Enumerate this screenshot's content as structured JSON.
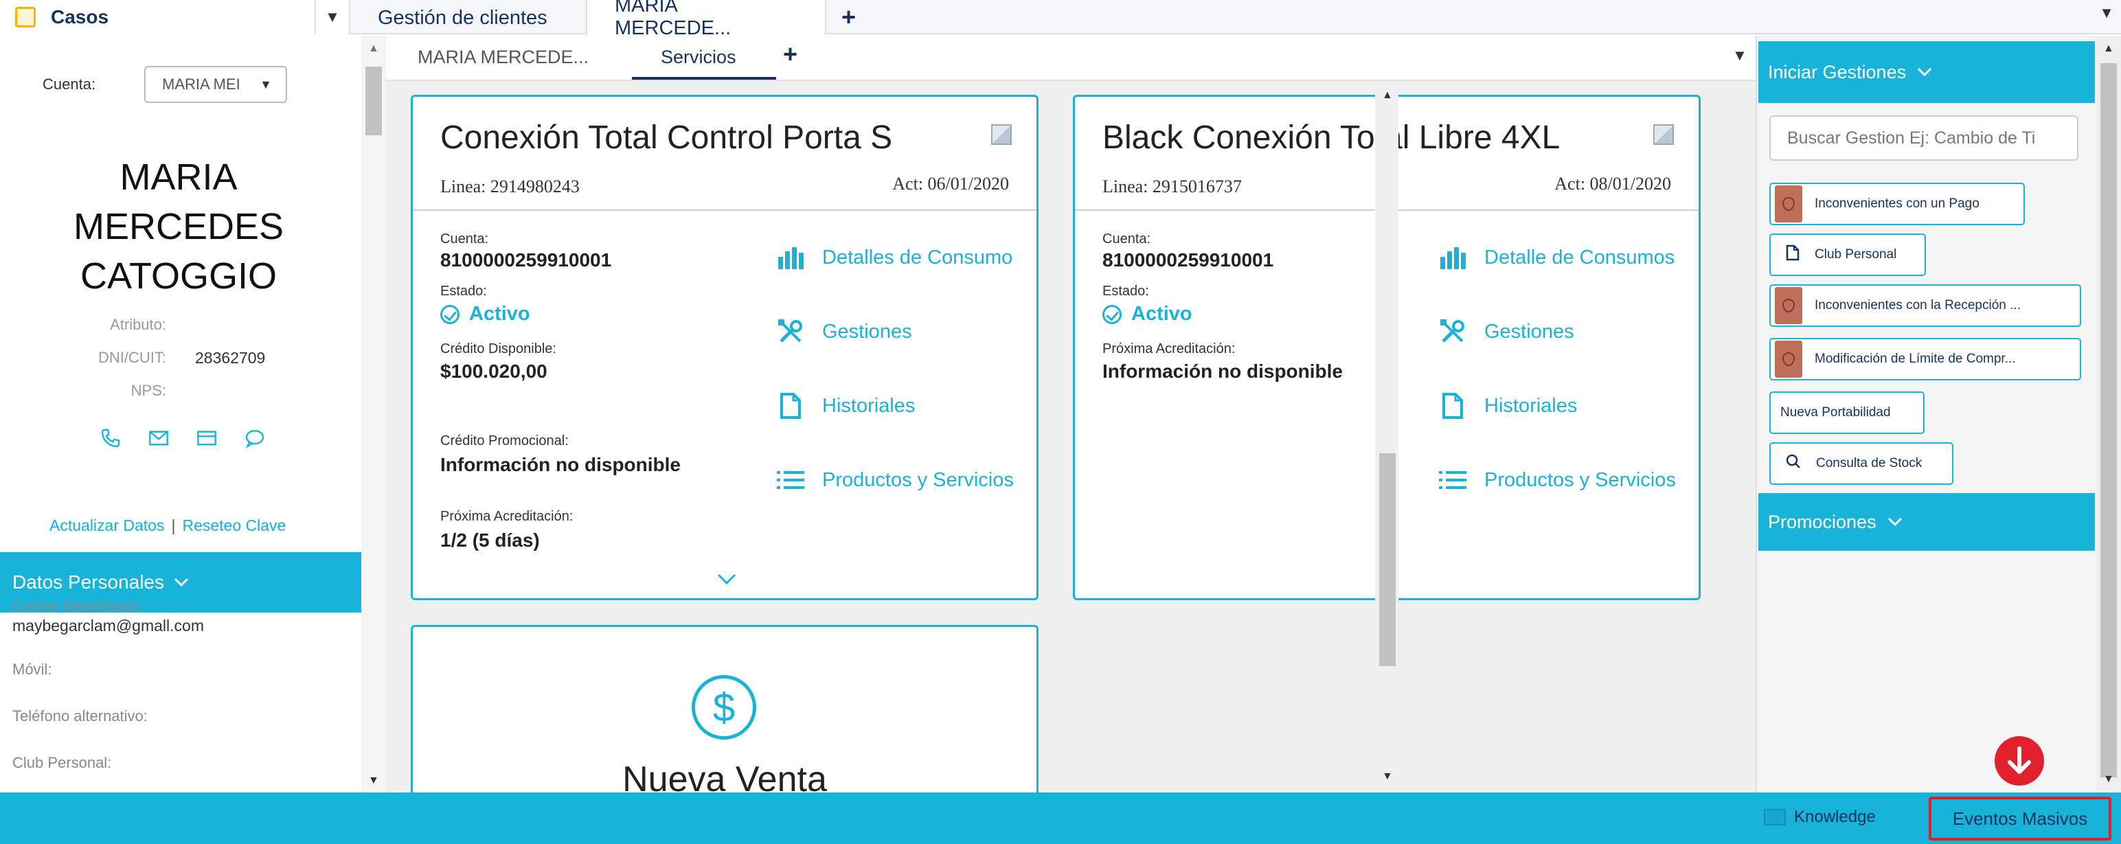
{
  "topbar": {
    "app_label": "Casos",
    "tabs": [
      {
        "label": "Gestión de clientes"
      },
      {
        "label": "MARIA MERCEDE..."
      }
    ]
  },
  "left_panel": {
    "cuenta_label": "Cuenta:",
    "cuenta_value": "MARIA MEI",
    "customer_name_lines": [
      "MARIA",
      "MERCEDES",
      "CATOGGIO"
    ],
    "atributo_label": "Atributo:",
    "dni_label": "DNI/CUIT:",
    "dni_value": "28362709",
    "nps_label": "NPS:",
    "link_update": "Actualizar Datos",
    "link_sep": "|",
    "link_reset": "Reseteo Clave",
    "datos_header": "Datos Personales",
    "fields": [
      {
        "label": "Correo Electrónico:",
        "value": "maybegarclam@gmall.com"
      },
      {
        "label": "Móvil:",
        "value": ""
      },
      {
        "label": "Teléfono alternativo:",
        "value": ""
      },
      {
        "label": "Club Personal:",
        "value": ""
      }
    ]
  },
  "center": {
    "subtabs": [
      {
        "label": "MARIA MERCEDE..."
      },
      {
        "label": "Servicios"
      }
    ],
    "cards": [
      {
        "plan": "Conexión Total Control Porta S",
        "linea": "Linea: 2914980243",
        "act": "Act: 06/01/2020",
        "cuenta_label": "Cuenta:",
        "cuenta_value": "8100000259910001",
        "estado_label": "Estado:",
        "estado_value": "Activo",
        "credito_label": "Crédito Disponible:",
        "credito_value": "$100.020,00",
        "credito_promo_label": "Crédito Promocional:",
        "credito_promo_value": "Información no disponible",
        "proxima_label": "Próxima Acreditación:",
        "proxima_value": "1/2 (5 días)",
        "actions": [
          "Detalles de Consumo",
          "Gestiones",
          "Historiales",
          "Productos y Servicios"
        ]
      },
      {
        "plan": "Black Conexión Total Libre 4XL",
        "linea": "Linea: 2915016737",
        "act": "Act: 08/01/2020",
        "cuenta_label": "Cuenta:",
        "cuenta_value": "8100000259910001",
        "estado_label": "Estado:",
        "estado_value": "Activo",
        "proxima_label": "Próxima Acreditación:",
        "proxima_value": "Información no disponible",
        "actions": [
          "Detalle de Consumos",
          "Gestiones",
          "Historiales",
          "Productos y Servicios"
        ]
      }
    ],
    "nueva_venta": "Nueva Venta"
  },
  "right_panel": {
    "iniciar_header": "Iniciar Gestiones",
    "search_placeholder": "Buscar Gestion Ej: Cambio de Ti",
    "gestiones": [
      {
        "label": "Inconvenientes con un Pago",
        "icon": "shield-badge"
      },
      {
        "label": "Club Personal",
        "icon": "document-icon"
      },
      {
        "label": "Inconvenientes con la Recepción ...",
        "icon": "shield-badge"
      },
      {
        "label": "Modificación de Límite de Compr...",
        "icon": "shield-badge"
      },
      {
        "label": "Nueva Portabilidad",
        "icon": ""
      },
      {
        "label": "Consulta de Stock",
        "icon": "search-icon"
      }
    ],
    "promociones_header": "Promociones"
  },
  "bottombar": {
    "knowledge": "Knowledge",
    "eventos": "Eventos Masivos"
  },
  "colors": {
    "accent": "#17b3d8",
    "navy": "#16325c",
    "alert_red": "#e0212d"
  }
}
